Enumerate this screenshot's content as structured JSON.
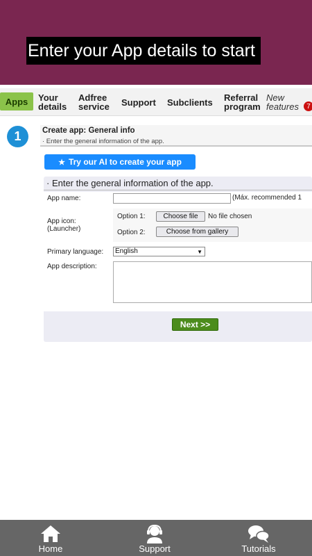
{
  "banner": {
    "title": "Enter your App details to start",
    "bg": "#7a2650"
  },
  "nav": {
    "items": [
      {
        "label": "Apps"
      },
      {
        "line1": "Your",
        "line2": "details"
      },
      {
        "line1": "Adfree",
        "line2": "service"
      },
      {
        "label": "Support"
      },
      {
        "label": "Subclients"
      },
      {
        "line1": "Referral",
        "line2": "program"
      },
      {
        "line1": "New",
        "line2": "features"
      }
    ],
    "badge": "7",
    "active_color": "#8bc34a"
  },
  "step": {
    "number": "1",
    "title": "Create app: General info",
    "subtitle": "· Enter the general information of the app."
  },
  "ai_button": {
    "icon": "star-icon",
    "label": "Try our AI to create your app"
  },
  "form": {
    "heading": "· Enter the general information of the app.",
    "app_name_label": "App name:",
    "app_name_value": "",
    "app_name_hint": "(Máx. recommended 1",
    "app_icon_label_line1": "App icon:",
    "app_icon_label_line2": "(Launcher)",
    "option1_label": "Option 1:",
    "choose_file_label": "Choose file",
    "no_file_text": "No file chosen",
    "option2_label": "Option 2:",
    "choose_gallery_label": "Choose from gallery",
    "language_label": "Primary language:",
    "language_value": "English",
    "description_label": "App description:",
    "description_value": "",
    "next_label": "Next >>"
  },
  "bottom_nav": [
    {
      "label": "Home",
      "icon": "home-icon"
    },
    {
      "label": "Support",
      "icon": "support-agent-icon"
    },
    {
      "label": "Tutorials",
      "icon": "chat-bubbles-icon"
    }
  ]
}
